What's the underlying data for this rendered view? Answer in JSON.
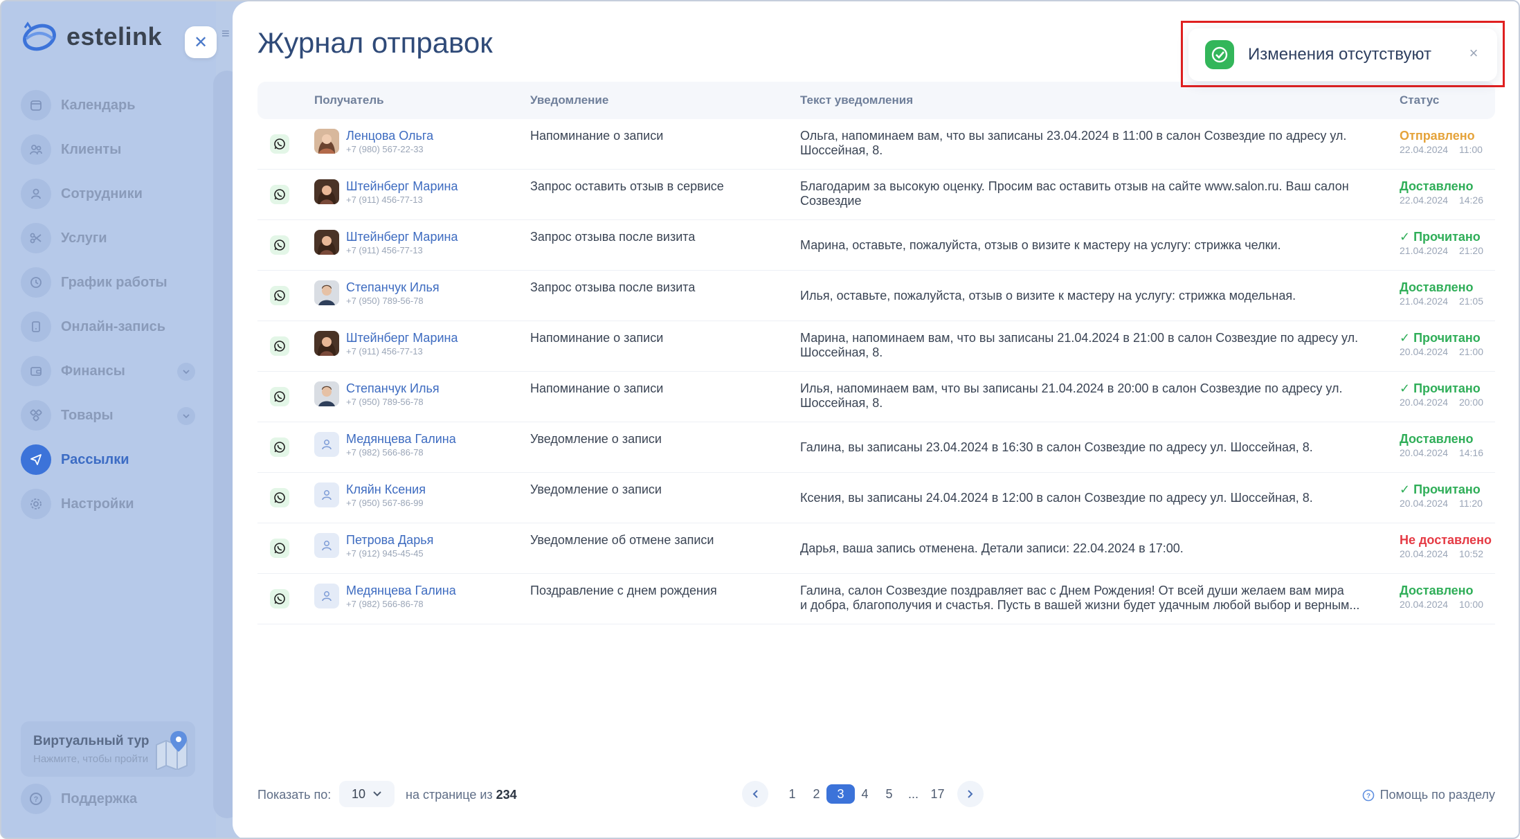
{
  "app": {
    "logo_text": "estelink"
  },
  "sidebar": {
    "items": [
      {
        "label": "Календарь",
        "icon": "calendar-icon",
        "expandable": false,
        "active": false
      },
      {
        "label": "Клиенты",
        "icon": "clients-icon",
        "expandable": false,
        "active": false
      },
      {
        "label": "Сотрудники",
        "icon": "user-icon",
        "expandable": false,
        "active": false
      },
      {
        "label": "Услуги",
        "icon": "scissors-icon",
        "expandable": false,
        "active": false
      },
      {
        "label": "График работы",
        "icon": "clock-icon",
        "expandable": false,
        "active": false
      },
      {
        "label": "Онлайн-запись",
        "icon": "phone-icon",
        "expandable": false,
        "active": false
      },
      {
        "label": "Финансы",
        "icon": "wallet-icon",
        "expandable": true,
        "active": false
      },
      {
        "label": "Товары",
        "icon": "boxes-icon",
        "expandable": true,
        "active": false
      },
      {
        "label": "Рассылки",
        "icon": "send-icon",
        "expandable": false,
        "active": true
      },
      {
        "label": "Настройки",
        "icon": "gear-icon",
        "expandable": false,
        "active": false
      }
    ],
    "tour": {
      "title": "Виртуальный тур",
      "subtitle": "Нажмите, чтобы пройти"
    },
    "support": "Поддержка"
  },
  "main": {
    "title": "Журнал отправок",
    "columns": {
      "recipient": "Получатель",
      "notification": "Уведомление",
      "text": "Текст уведомления",
      "status": "Статус"
    },
    "rows": [
      {
        "name": "Ленцова Ольга",
        "phone": "+7 (980) 567-22-33",
        "avatar": "photo-woman-1",
        "notif": "Напоминание о записи",
        "text": "Ольга, напоминаем вам, что вы записаны 23.04.2024 в 11:00 в салон Созвездие по адресу ул.\nШоссейная, 8.",
        "status": "Отправлено",
        "status_kind": "sent",
        "date": "22.04.2024",
        "time": "11:00"
      },
      {
        "name": "Штейнберг Марина",
        "phone": "+7 (911) 456-77-13",
        "avatar": "photo-woman-2",
        "notif": "Запрос оставить отзыв в сервисе",
        "text": "Благодарим за высокую оценку. Просим вас оставить отзыв на сайте www.salon.ru. Ваш салон\nСозвездие",
        "status": "Доставлено",
        "status_kind": "delivered",
        "date": "22.04.2024",
        "time": "14:26"
      },
      {
        "name": "Штейнберг Марина",
        "phone": "+7 (911) 456-77-13",
        "avatar": "photo-woman-2",
        "notif": "Запрос отзыва после визита",
        "text": "Марина, оставьте, пожалуйста, отзыв о визите к мастеру на услугу: стрижка челки.",
        "status": "Прочитано",
        "status_kind": "read",
        "date": "21.04.2024",
        "time": "21:20"
      },
      {
        "name": "Степанчук Илья",
        "phone": "+7 (950) 789-56-78",
        "avatar": "photo-man-1",
        "notif": "Запрос отзыва после визита",
        "text": "Илья, оставьте, пожалуйста, отзыв о визите к мастеру на услугу: стрижка модельная.",
        "status": "Доставлено",
        "status_kind": "delivered",
        "date": "21.04.2024",
        "time": "21:05"
      },
      {
        "name": "Штейнберг Марина",
        "phone": "+7 (911) 456-77-13",
        "avatar": "photo-woman-2",
        "notif": "Напоминание о записи",
        "text": "Марина, напоминаем вам, что вы записаны 21.04.2024 в 21:00 в салон Созвездие по адресу ул.\nШоссейная, 8.",
        "status": "Прочитано",
        "status_kind": "read",
        "date": "20.04.2024",
        "time": "21:00"
      },
      {
        "name": "Степанчук Илья",
        "phone": "+7 (950) 789-56-78",
        "avatar": "photo-man-1",
        "notif": "Напоминание о записи",
        "text": "Илья, напоминаем вам, что вы записаны 21.04.2024 в 20:00 в салон Созвездие по адресу ул.\nШоссейная, 8.",
        "status": "Прочитано",
        "status_kind": "read",
        "date": "20.04.2024",
        "time": "20:00"
      },
      {
        "name": "Медянцева Галина",
        "phone": "+7 (982) 566-86-78",
        "avatar": "placeholder",
        "notif": "Уведомление о записи",
        "text": "Галина, вы записаны 23.04.2024 в 16:30 в салон Созвездие по адресу ул. Шоссейная, 8.",
        "status": "Доставлено",
        "status_kind": "delivered",
        "date": "20.04.2024",
        "time": "14:16"
      },
      {
        "name": "Кляйн Ксения",
        "phone": "+7 (950) 567-86-99",
        "avatar": "placeholder",
        "notif": "Уведомление о записи",
        "text": "Ксения, вы записаны 24.04.2024 в 12:00 в салон Созвездие по адресу ул. Шоссейная, 8.",
        "status": "Прочитано",
        "status_kind": "read",
        "date": "20.04.2024",
        "time": "11:20"
      },
      {
        "name": "Петрова Дарья",
        "phone": "+7 (912) 945-45-45",
        "avatar": "placeholder",
        "notif": "Уведомление об отмене записи",
        "text": "Дарья, ваша запись отменена. Детали записи: 22.04.2024 в 17:00.",
        "status": "Не доставлено",
        "status_kind": "failed",
        "date": "20.04.2024",
        "time": "10:52"
      },
      {
        "name": "Медянцева Галина",
        "phone": "+7 (982) 566-86-78",
        "avatar": "placeholder",
        "notif": "Поздравление с днем рождения",
        "text": "Галина, салон Созвездие поздравляет вас с Днем Рождения! От всей души желаем вам мира\nи добра, благополучия и счастья. Пусть в вашей жизни будет удачным любой выбор и верным...",
        "status": "Доставлено",
        "status_kind": "delivered",
        "date": "20.04.2024",
        "time": "10:00"
      }
    ],
    "footer": {
      "show_label": "Показать по:",
      "page_size": "10",
      "of_label": "на странице из",
      "total": "234",
      "pages": [
        "1",
        "2",
        "3",
        "4",
        "5",
        "...",
        "17"
      ],
      "current_page": "3",
      "help": "Помощь по разделу"
    }
  },
  "toast": {
    "text": "Изменения отсутствуют"
  },
  "colors": {
    "accent": "#3c73d9",
    "success": "#2fae58",
    "warning": "#e5a33a",
    "danger": "#e53a44",
    "sidebar": "#b6c9e9",
    "title": "#2f4a78"
  }
}
